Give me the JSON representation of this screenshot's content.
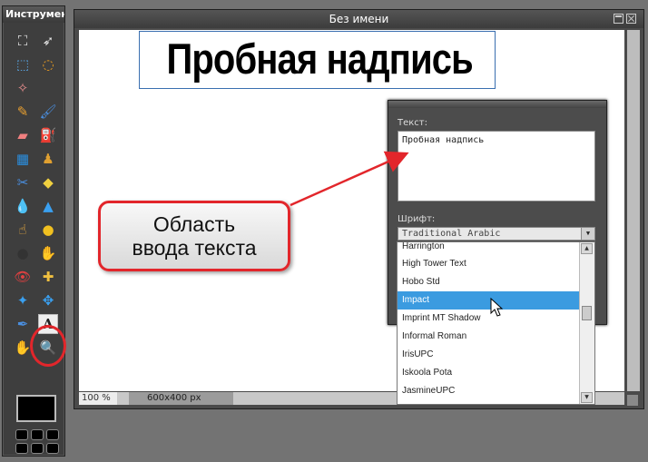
{
  "toolbox": {
    "title": "Инструмент",
    "tools": [
      {
        "name": "crop-icon",
        "glyph": "⛶"
      },
      {
        "name": "move-icon",
        "glyph": "➶"
      },
      {
        "name": "marquee-select-icon",
        "glyph": "⬚"
      },
      {
        "name": "lasso-icon",
        "glyph": "◌"
      },
      {
        "name": "magic-wand-icon",
        "glyph": "✧"
      },
      {
        "name": "blank-slot",
        "glyph": ""
      },
      {
        "name": "pencil-icon",
        "glyph": "✎"
      },
      {
        "name": "brush-icon",
        "glyph": "🖌"
      },
      {
        "name": "eraser-icon",
        "glyph": "▰"
      },
      {
        "name": "paint-bucket-icon",
        "glyph": "⛽"
      },
      {
        "name": "gradient-icon",
        "glyph": "▦"
      },
      {
        "name": "clone-stamp-icon",
        "glyph": "♟"
      },
      {
        "name": "color-replace-icon",
        "glyph": "✂"
      },
      {
        "name": "shape-icon",
        "glyph": "◆"
      },
      {
        "name": "blur-drop-icon",
        "glyph": "💧"
      },
      {
        "name": "sharpen-icon",
        "glyph": "▲"
      },
      {
        "name": "smudge-icon",
        "glyph": "☝"
      },
      {
        "name": "sponge-icon",
        "glyph": "●"
      },
      {
        "name": "burn-icon",
        "glyph": "●"
      },
      {
        "name": "dodge-icon",
        "glyph": "✋"
      },
      {
        "name": "red-eye-icon",
        "glyph": "👁"
      },
      {
        "name": "spot-heal-icon",
        "glyph": "✚"
      },
      {
        "name": "bloat-icon",
        "glyph": "✦"
      },
      {
        "name": "pinch-icon",
        "glyph": "✥"
      },
      {
        "name": "color-picker-icon",
        "glyph": "✒"
      },
      {
        "name": "text-tool-icon",
        "glyph": "A"
      },
      {
        "name": "hand-icon",
        "glyph": "✋"
      },
      {
        "name": "zoom-icon",
        "glyph": "🔍"
      }
    ],
    "swatch_count": 6
  },
  "document": {
    "title": "Без имени",
    "canvas_text": "Пробная надпись",
    "zoom": "100 %",
    "size": "600x400 px"
  },
  "text_dialog": {
    "text_label": "Текст:",
    "text_value": "Пробная надпись",
    "font_label": "Шрифт:",
    "font_value": "Traditional Arabic",
    "font_list": [
      "Harrington",
      "High Tower Text",
      "Hobo Std",
      "Impact",
      "Imprint MT Shadow",
      "Informal Roman",
      "IrisUPC",
      "Iskoola Pota",
      "JasmineUPC"
    ],
    "selected_font": "Impact"
  },
  "callout": {
    "line1": "Область",
    "line2": "ввода текста"
  },
  "colors": {
    "accent_red": "#e2262b",
    "selection_blue": "#3b9be0"
  }
}
